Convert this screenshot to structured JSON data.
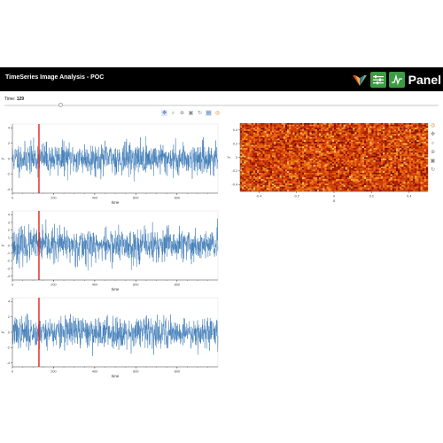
{
  "app": {
    "title": "TimeSeries Image Analysis - POC",
    "brand_name": "Panel",
    "accent_color": "#000000"
  },
  "time_widget": {
    "label": "Time:",
    "value": "129",
    "min": 0,
    "max": 999,
    "current": 129
  },
  "toolbar": {
    "top": [
      "pan-icon",
      "box-zoom-icon",
      "wheel-zoom-icon",
      "save-icon",
      "reset-icon",
      "hover-icon",
      "bokeh-logo-icon"
    ],
    "side": [
      "bokeh-logo-icon",
      "pan-icon",
      "box-zoom-icon",
      "wheel-zoom-icon",
      "save-icon",
      "reset-icon"
    ]
  },
  "chart_data": [
    {
      "type": "line",
      "name": "timeseries-1",
      "xlabel": "time",
      "ylabel": "y",
      "xlim": [
        0,
        999
      ],
      "ylim": [
        -4.5,
        4.5
      ],
      "xticks": [
        "0",
        "200",
        "400",
        "600",
        "800"
      ],
      "yticks": [
        "-4",
        "-2",
        "0",
        "2",
        "4"
      ],
      "marker_x": 129,
      "line_color": "#3a78b5",
      "marker_color": "#e4201a",
      "n_points": 1000,
      "seed": 11,
      "std": 1.0
    },
    {
      "type": "line",
      "name": "timeseries-2",
      "xlabel": "time",
      "ylabel": "y",
      "xlim": [
        0,
        999
      ],
      "ylim": [
        -4.5,
        4.5
      ],
      "xticks": [
        "0",
        "200",
        "400",
        "600",
        "800"
      ],
      "yticks": [
        "-4",
        "-3",
        "-2",
        "-1",
        "0",
        "1",
        "2",
        "3",
        "4"
      ],
      "marker_x": 129,
      "line_color": "#3a78b5",
      "marker_color": "#e4201a",
      "n_points": 1000,
      "seed": 23,
      "std": 1.1
    },
    {
      "type": "line",
      "name": "timeseries-3",
      "xlabel": "time",
      "ylabel": "y",
      "xlim": [
        0,
        999
      ],
      "ylim": [
        -4.5,
        4.5
      ],
      "xticks": [
        "0",
        "200",
        "400",
        "600",
        "800"
      ],
      "yticks": [
        "-4",
        "-2",
        "0",
        "2",
        "4"
      ],
      "marker_x": 129,
      "line_color": "#3a78b5",
      "marker_color": "#e4201a",
      "n_points": 1000,
      "seed": 37,
      "std": 1.0
    },
    {
      "type": "heatmap",
      "name": "image",
      "xlabel": "x",
      "ylabel": "y",
      "xlim": [
        -0.5,
        0.5
      ],
      "ylim": [
        -0.5,
        0.5
      ],
      "xticks": [
        "-0.4",
        "-0.2",
        "0",
        "0.2",
        "0.4"
      ],
      "yticks": [
        "-0.4",
        "-0.2",
        "0",
        "0.2",
        "0.4"
      ],
      "cols": 100,
      "rows": 44,
      "seed": 5,
      "colormap": [
        "#7a0a00",
        "#a81c00",
        "#cf3a03",
        "#e8610c",
        "#f29324",
        "#f7c455"
      ]
    }
  ]
}
